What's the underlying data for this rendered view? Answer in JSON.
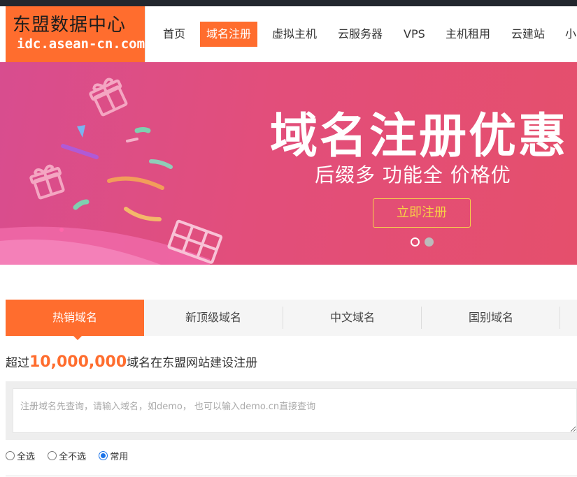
{
  "logo": {
    "title": "东盟数据中心",
    "url": "idc.asean-cn.com"
  },
  "nav": {
    "items": [
      "首页",
      "域名注册",
      "虚拟主机",
      "云服务器",
      "VPS",
      "主机租用",
      "云建站",
      "小"
    ],
    "active": "域名注册"
  },
  "banner": {
    "title": "域名注册优惠",
    "subtitle": "后缀多  功能全  价格优",
    "button": "立即注册"
  },
  "tabs": [
    "热销域名",
    "新顶级域名",
    "中文域名",
    "国别域名"
  ],
  "stat": {
    "prefix": "超过",
    "number": "10,000,000",
    "suffix": "域名在东盟网站建设注册"
  },
  "search": {
    "placeholder": "注册域名先查询，请输入域名，如demo， 也可以输入demo.cn直接查询",
    "value": ""
  },
  "options": [
    {
      "label": "全选",
      "checked": false
    },
    {
      "label": "全不选",
      "checked": false
    },
    {
      "label": "常用",
      "checked": true
    }
  ],
  "colors": {
    "accent": "#ff6d2e",
    "banner_start": "#d84d8f",
    "banner_end": "#e54f6c",
    "button_border": "#f6d24a"
  },
  "icons": [
    "gift-icon",
    "gift-icon",
    "gift-icon"
  ]
}
